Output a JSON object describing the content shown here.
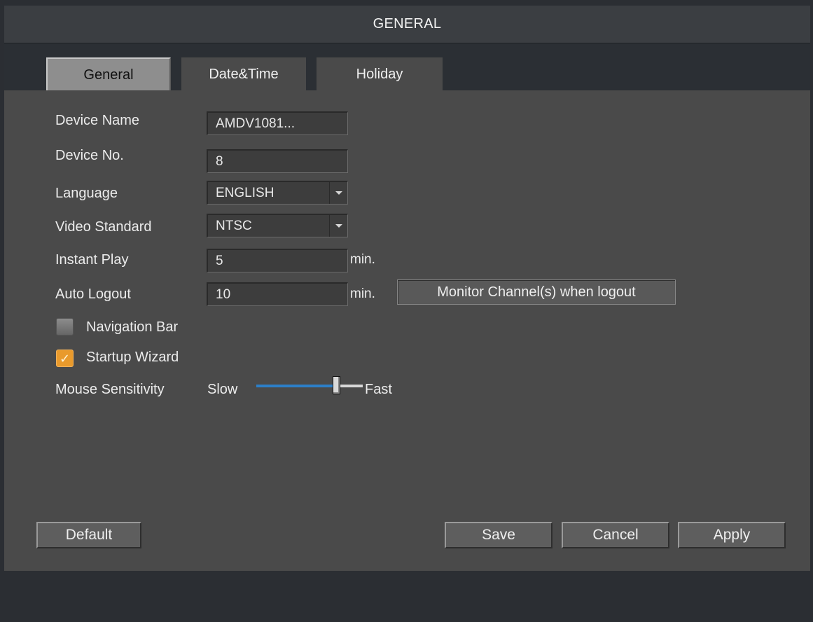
{
  "title": "GENERAL",
  "tabs": [
    {
      "label": "General",
      "active": true
    },
    {
      "label": "Date&Time",
      "active": false
    },
    {
      "label": "Holiday",
      "active": false
    }
  ],
  "fields": {
    "device_name": {
      "label": "Device Name",
      "value": "AMDV1081..."
    },
    "device_no": {
      "label": "Device No.",
      "value": "8"
    },
    "language": {
      "label": "Language",
      "value": "ENGLISH"
    },
    "video_standard": {
      "label": "Video Standard",
      "value": "NTSC"
    },
    "instant_play": {
      "label": "Instant Play",
      "value": "5",
      "unit": "min."
    },
    "auto_logout": {
      "label": "Auto Logout",
      "value": "10",
      "unit": "min."
    }
  },
  "monitor_button": "Monitor Channel(s) when logout",
  "checkboxes": {
    "navigation_bar": {
      "label": "Navigation Bar",
      "checked": false
    },
    "startup_wizard": {
      "label": "Startup Wizard",
      "checked": true
    }
  },
  "mouse_sensitivity": {
    "label": "Mouse Sensitivity",
    "slow_label": "Slow",
    "fast_label": "Fast",
    "level": 0.75
  },
  "buttons": {
    "default": "Default",
    "save": "Save",
    "cancel": "Cancel",
    "apply": "Apply"
  },
  "colors": {
    "accent": "#e99a2c",
    "slider": "#2c7fc8"
  }
}
